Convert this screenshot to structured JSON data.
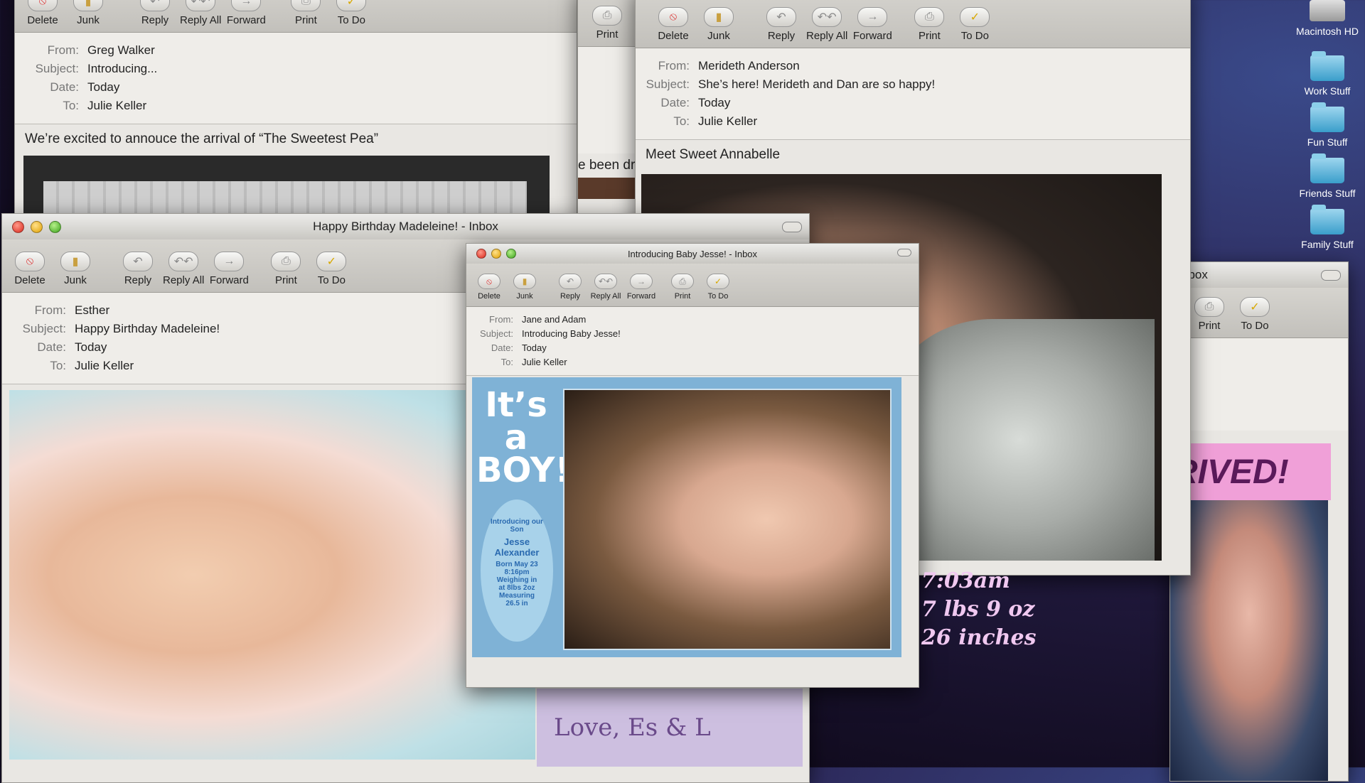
{
  "desktop": {
    "icons": [
      {
        "label": "Macintosh HD",
        "icon": "hard-drive-icon"
      },
      {
        "label": "Work Stuff",
        "icon": "folder-icon"
      },
      {
        "label": "Fun Stuff",
        "icon": "folder-icon"
      },
      {
        "label": "Friends Stuff",
        "icon": "folder-icon"
      },
      {
        "label": "Family Stuff",
        "icon": "folder-icon"
      }
    ]
  },
  "toolbar": {
    "delete": "Delete",
    "junk": "Junk",
    "reply": "Reply",
    "reply_all": "Reply All",
    "forward": "Forward",
    "print": "Print",
    "todo": "To Do"
  },
  "labels": {
    "from": "From:",
    "subject": "Subject:",
    "date": "Date:",
    "to": "To:"
  },
  "win_greg": {
    "from": "Greg Walker",
    "subject": "Introducing...",
    "date": "Today",
    "to": "Julie Keller",
    "body": "We’re excited to annouce the arrival of “The Sweetest Pea”"
  },
  "win_partial_left": {
    "print": "Print",
    "text": "e been dr"
  },
  "win_merideth": {
    "from": "Merideth Anderson",
    "subject": "She’s here! Merideth and Dan are so happy!",
    "date": "Today",
    "to": "Julie Keller",
    "body": "Meet Sweet Annabelle"
  },
  "win_right": {
    "title": "nbox",
    "print": "Print",
    "todo": "To Do",
    "banner": "RIVED!",
    "overlay": [
      "7:03am",
      "7 lbs 9 oz",
      "26 inches"
    ]
  },
  "win_madeleine": {
    "title": "Happy Birthday Madeleine! - Inbox",
    "from": "Esther",
    "subject": "Happy Birthday Madeleine!",
    "date": "Today",
    "to": "Julie Keller",
    "signature": "Love, Es & L"
  },
  "win_jesse": {
    "title": "Introducing Baby Jesse! - Inbox",
    "from": "Jane and Adam",
    "subject": "Introducing Baby Jesse!",
    "date": "Today",
    "to": "Julie Keller",
    "card_headline": [
      "It’s",
      "a",
      "BOY!"
    ],
    "card_intro": "Introducing our Son",
    "card_name": "Jesse Alexander",
    "card_details": "Born May 23 8:16pm Weighing in at 8lbs 2oz Measuring 26.5 in"
  },
  "colors": {
    "card_blue": "#7fb2d6",
    "banner_pink": "#f0a0d8",
    "signature_bg": "#cdbfe0"
  }
}
